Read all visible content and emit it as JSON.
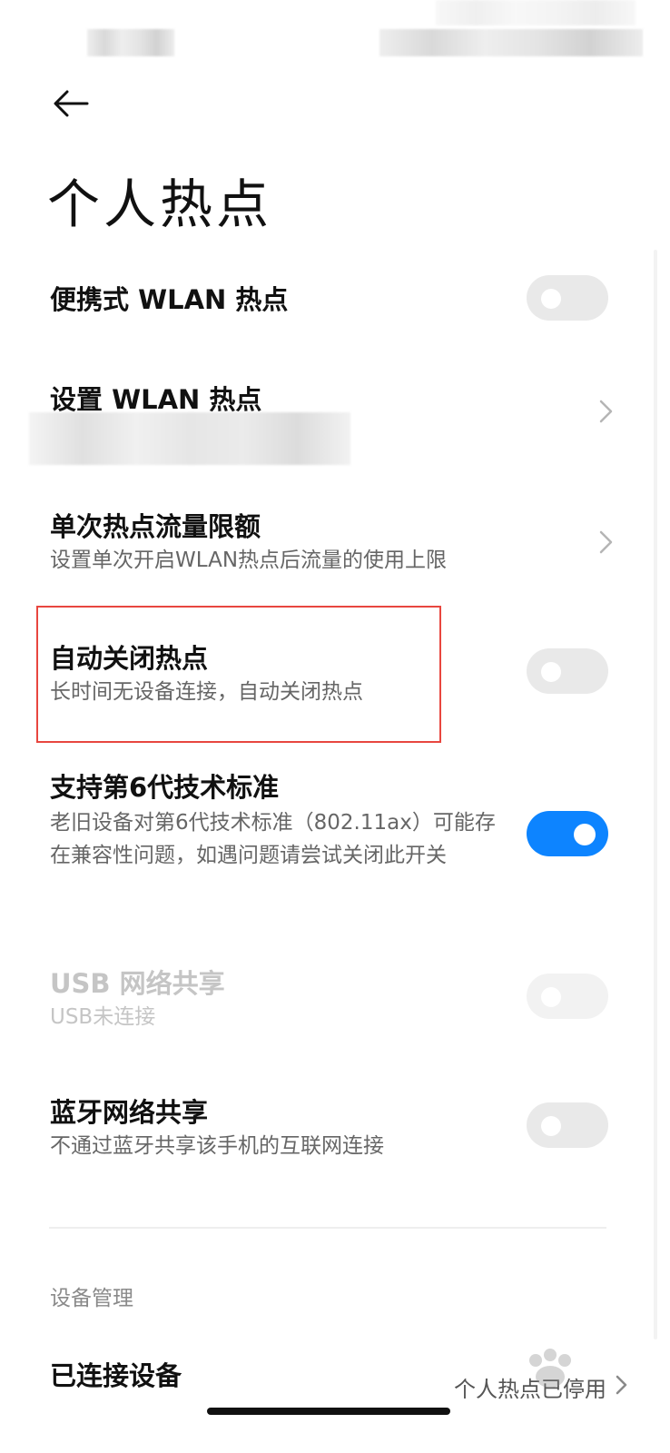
{
  "page": {
    "title": "个人热点"
  },
  "settings": [
    {
      "title": "便携式 WLAN 热点",
      "subtitle": "",
      "control": "toggle",
      "state": "off"
    },
    {
      "title": "设置 WLAN 热点",
      "subtitle": "",
      "control": "chevron"
    },
    {
      "title": "单次热点流量限额",
      "subtitle": "设置单次开启WLAN热点后流量的使用上限",
      "control": "chevron"
    },
    {
      "title": "自动关闭热点",
      "subtitle": "长时间无设备连接，自动关闭热点",
      "control": "toggle",
      "state": "off"
    },
    {
      "title": "支持第6代技术标准",
      "subtitle": "老旧设备对第6代技术标准（802.11ax）可能存在兼容性问题，如遇问题请尝试关闭此开关",
      "control": "toggle",
      "state": "on"
    },
    {
      "title": "USB 网络共享",
      "subtitle": "USB未连接",
      "control": "toggle",
      "state": "disabled"
    },
    {
      "title": "蓝牙网络共享",
      "subtitle": "不通过蓝牙共享该手机的互联网连接",
      "control": "toggle",
      "state": "off"
    }
  ],
  "section": {
    "label": "设备管理"
  },
  "connected_devices": {
    "title": "已连接设备",
    "footer_text": "个人热点已停用"
  },
  "colors": {
    "accent": "#0d84ff",
    "highlight_border": "#e8463f",
    "toggle_off": "#e9e9e9"
  }
}
